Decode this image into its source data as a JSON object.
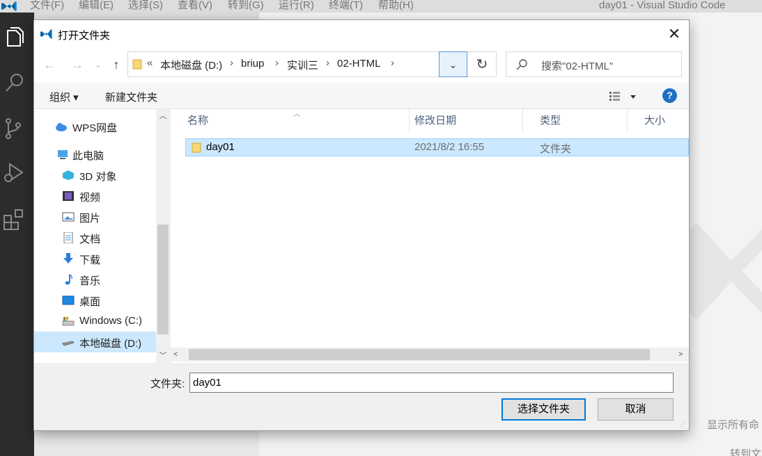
{
  "vscode": {
    "menu": [
      "文件(F)",
      "编辑(E)",
      "选择(S)",
      "查看(V)",
      "转到(G)",
      "运行(R)",
      "终端(T)",
      "帮助(H)"
    ],
    "window_title": "day01 - Visual Studio Code",
    "hint_show": "显示所有命",
    "hint_goto": "转到文",
    "activity_icons": [
      "explorer-icon",
      "search-icon",
      "source-control-icon",
      "run-debug-icon",
      "extensions-icon"
    ]
  },
  "dialog": {
    "title": "打开文件夹",
    "close_label": "✕",
    "address": {
      "overflow": "«",
      "segments": [
        "本地磁盘 (D:)",
        "briup",
        "实训三",
        "02-HTML"
      ]
    },
    "search_placeholder": "搜索\"02-HTML\"",
    "toolbar": {
      "organize": "组织 ▾",
      "new_folder": "新建文件夹",
      "help": "?"
    },
    "nav_items": [
      {
        "label": "WPS网盘",
        "icon": "cloud-icon"
      },
      {
        "label": "此电脑",
        "icon": "computer-icon"
      },
      {
        "label": "3D 对象",
        "icon": "3d-objects-icon"
      },
      {
        "label": "视频",
        "icon": "video-icon"
      },
      {
        "label": "图片",
        "icon": "pictures-icon"
      },
      {
        "label": "文档",
        "icon": "documents-icon"
      },
      {
        "label": "下载",
        "icon": "download-icon"
      },
      {
        "label": "音乐",
        "icon": "music-icon"
      },
      {
        "label": "桌面",
        "icon": "desktop-icon"
      },
      {
        "label": "Windows (C:)",
        "icon": "drive-c-icon"
      },
      {
        "label": "本地磁盘 (D:)",
        "icon": "drive-d-icon"
      }
    ],
    "columns": [
      "名称",
      "修改日期",
      "类型",
      "大小"
    ],
    "files": [
      {
        "name": "day01",
        "modified": "2021/8/2 16:55",
        "type": "文件夹"
      }
    ],
    "folder_label": "文件夹:",
    "folder_value": "day01",
    "select_button": "选择文件夹",
    "cancel_button": "取消",
    "colors": {
      "accent": "#0078d7",
      "selection": "#cce8ff",
      "folder": "#f8d775"
    }
  }
}
